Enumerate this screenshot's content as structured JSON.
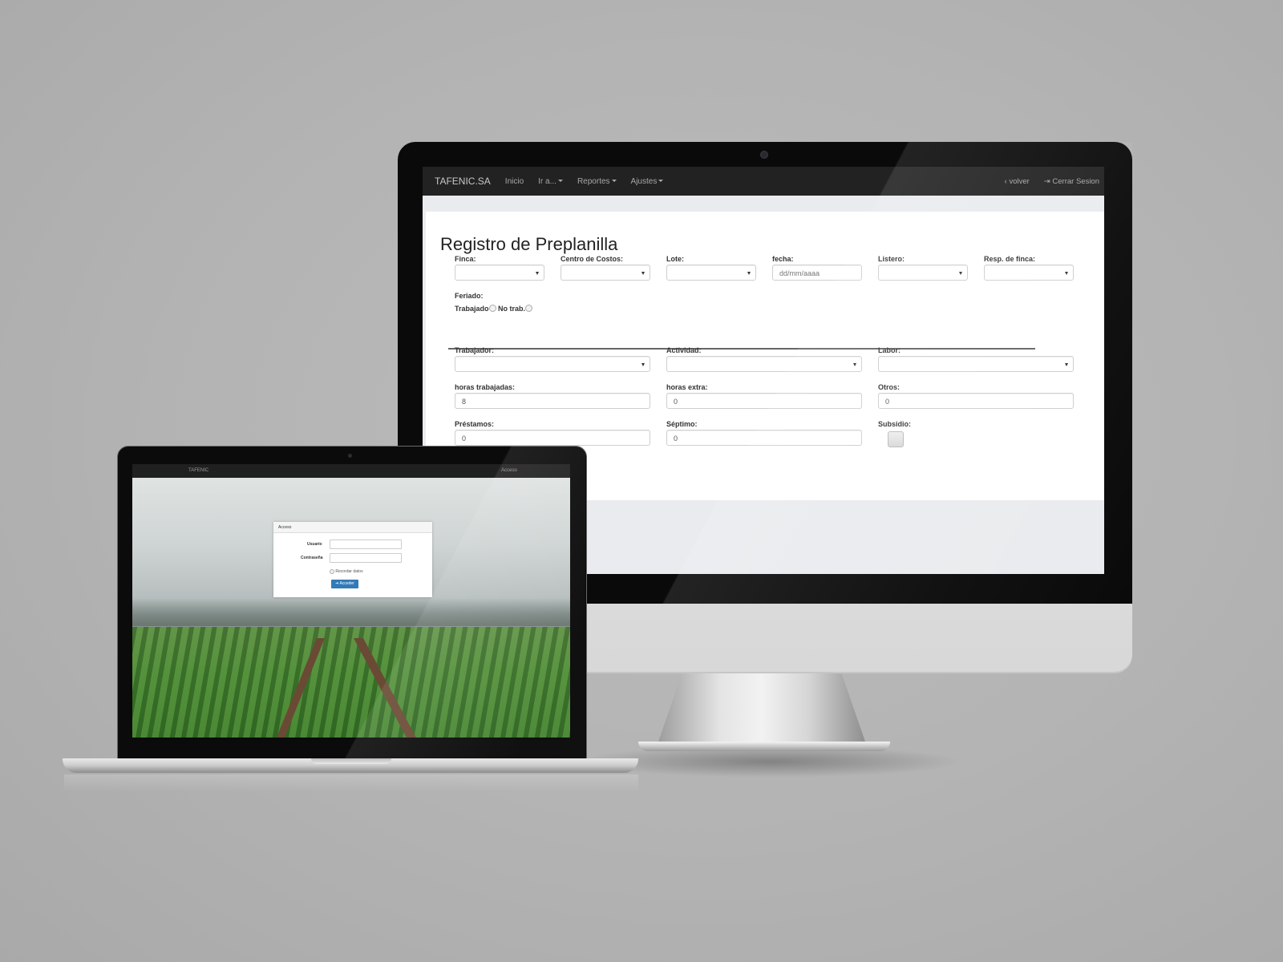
{
  "desktop": {
    "navbar": {
      "brand": "TAFENIC.SA",
      "items": [
        {
          "label": "Inicio"
        },
        {
          "label": "Ir a..."
        },
        {
          "label": "Reportes"
        },
        {
          "label": "Ajustes"
        }
      ],
      "right": {
        "back_label": "volver",
        "logout_label": "Cerrar Sesion"
      }
    },
    "page_title": "Registro de Preplanilla",
    "form": {
      "finca_label": "Finca:",
      "centro_label": "Centro de Costos:",
      "lote_label": "Lote:",
      "fecha_label": "fecha:",
      "fecha_placeholder": "dd/mm/aaaa",
      "listero_label": "Listero:",
      "resp_label": "Resp. de finca:",
      "feriado_label": "Feriado:",
      "trabajado_label": "Trabajado",
      "no_trab_label": "No trab.",
      "trabajador_label": "Trabajador:",
      "actividad_label": "Actividad:",
      "labor_label": "Labor:",
      "horas_label": "horas trabajadas:",
      "horas_value": "8",
      "extra_label": "horas extra:",
      "extra_value": "0",
      "otros_label": "Otros:",
      "otros_value": "0",
      "prestamos_label": "Préstamos:",
      "prestamos_value": "0",
      "septimo_label": "Séptimo:",
      "septimo_value": "0",
      "subsidio_label": "Subsidio:"
    }
  },
  "laptop": {
    "navbar": {
      "brand": "TAFENIC",
      "access_link": "Acceso"
    },
    "login": {
      "header": "Acceso",
      "user_label": "Usuario",
      "password_label": "Contraseña",
      "remember_label": "Recordar datos",
      "submit_label": "Acceder"
    }
  },
  "colors": {
    "navbar": "#222222",
    "primary_button": "#337ab7",
    "background": "#b3b3b3"
  }
}
